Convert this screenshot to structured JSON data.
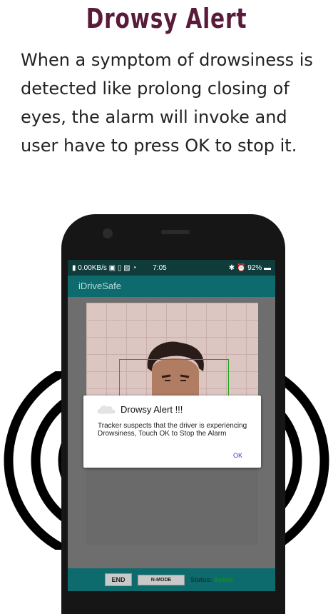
{
  "header": {
    "title": "Drowsy Alert",
    "description": "When a symptom of drowsiness is detected like prolong closing of eyes, the alarm will invoke and user have to press OK to stop it."
  },
  "statusbar": {
    "left": "0.00KB/s",
    "time": "7:05",
    "battery": "92%"
  },
  "app": {
    "title": "iDriveSafe"
  },
  "bottom_bar": {
    "end_label": "END",
    "nmode_label": "N-MODE",
    "status_label": "Status:",
    "status_value": "Active"
  },
  "dialog": {
    "title": "Drowsy Alert !!!",
    "message": "Tracker suspects that the driver is experiencing Drowsiness, Touch OK to Stop the Alarm",
    "ok_label": "OK"
  },
  "colors": {
    "title": "#5a1a3a",
    "appbar": "#0d6b6d",
    "statusbar": "#0f3b3b",
    "facebox": "#1fa31f",
    "ok": "#3b3bc4"
  }
}
